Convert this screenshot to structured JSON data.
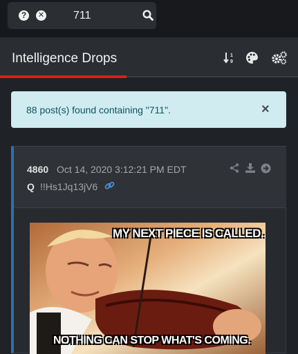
{
  "search": {
    "value": "711",
    "help_icon": "question-circle-icon",
    "clear_icon": "times-circle-icon",
    "submit_icon": "search-icon"
  },
  "header": {
    "title": "Intelligence Drops",
    "sort_icon": "sort-numeric-icon",
    "theme_icon": "palette-icon",
    "settings_icon": "gears-icon",
    "accent_color": "#d41f1f"
  },
  "alert": {
    "text": "88 post(s) found containing \"711\".",
    "close_label": "×"
  },
  "post": {
    "number": "4860",
    "date": "Oct 14, 2020 3:12:21 PM EDT",
    "author": "Q",
    "tripcode": "!!Hs1Jq13jV6",
    "accent_color": "#2f6fb0",
    "actions": [
      "share-icon",
      "download-icon",
      "arrow-right-circle-icon"
    ],
    "image": {
      "top_text": "MY NEXT PIECE IS CALLED...",
      "bottom_text": "NOTHING CAN STOP WHAT'S COMING."
    }
  }
}
